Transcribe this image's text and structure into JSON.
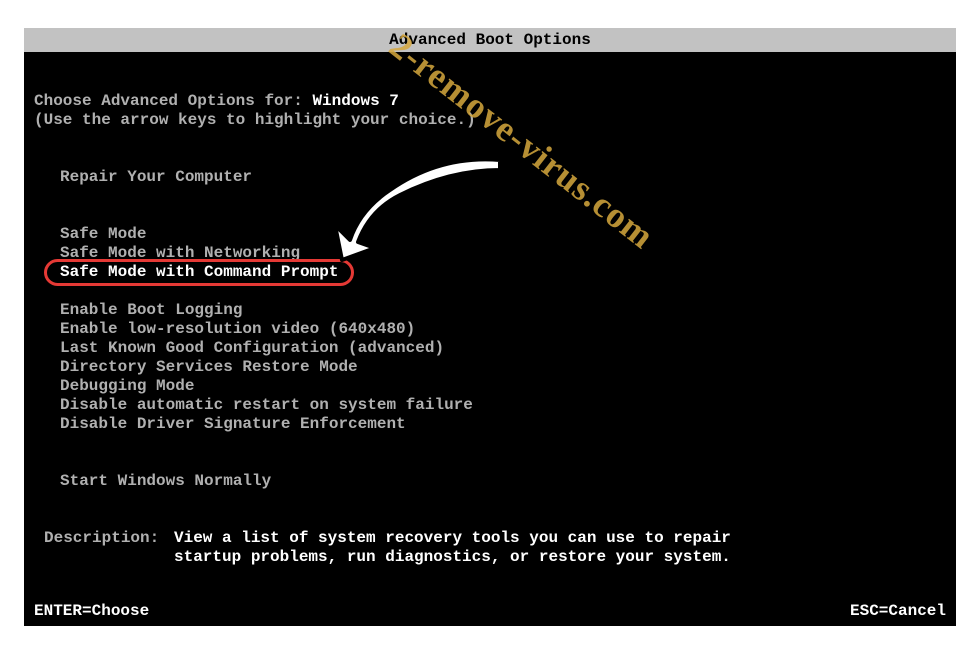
{
  "title": "Advanced Boot Options",
  "choose_label": "Choose Advanced Options for: ",
  "os_name": "Windows 7",
  "hint": "(Use the arrow keys to highlight your choice.)",
  "groups": [
    {
      "items": [
        "Repair Your Computer"
      ]
    },
    {
      "items": [
        "Safe Mode",
        "Safe Mode with Networking",
        "Safe Mode with Command Prompt"
      ],
      "highlight_index": 2
    },
    {
      "items": [
        "Enable Boot Logging",
        "Enable low-resolution video (640x480)",
        "Last Known Good Configuration (advanced)",
        "Directory Services Restore Mode",
        "Debugging Mode",
        "Disable automatic restart on system failure",
        "Disable Driver Signature Enforcement"
      ]
    },
    {
      "items": [
        "Start Windows Normally"
      ]
    }
  ],
  "description_label": "Description:",
  "description_text": "View a list of system recovery tools you can use to repair\nstartup problems, run diagnostics, or restore your system.",
  "footer_left": "ENTER=Choose",
  "footer_right": "ESC=Cancel",
  "watermark": "2-remove-virus.com"
}
